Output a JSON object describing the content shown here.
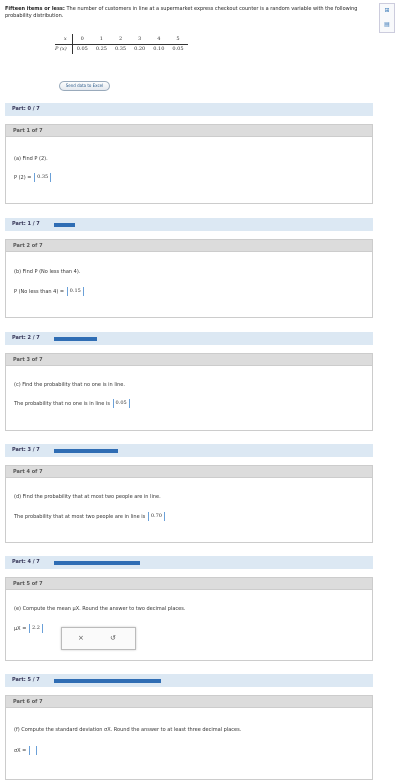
{
  "problem": {
    "title": "Fifteen items or less:",
    "text": "The number of customers in line at a supermarket express checkout counter is a random variable with the following probability distribution."
  },
  "distribution": {
    "x_label": "x",
    "p_label": "P (x)",
    "x_values": [
      "0",
      "1",
      "2",
      "3",
      "4",
      "5"
    ],
    "p_values": [
      "0.05",
      "0.25",
      "0.35",
      "0.20",
      "0.10",
      "0.05"
    ]
  },
  "send_button_label": "Send data to Excel",
  "tools": {
    "calc": "⊞",
    "table": "▤"
  },
  "parts": [
    {
      "bar": "Part: 0 / 7",
      "progress": 0,
      "head": "Part 1 of 7",
      "question": "(a) Find P (2).",
      "answer_label": "P (2) =",
      "answer": "0.35"
    },
    {
      "bar": "Part: 1 / 7",
      "progress": 0.143,
      "head": "Part 2 of 7",
      "question": "(b) Find P (No less than 4).",
      "answer_label": "P (No less than 4) =",
      "answer": "0.15"
    },
    {
      "bar": "Part: 2 / 7",
      "progress": 0.286,
      "head": "Part 3 of 7",
      "question": "(c) Find the probability that no one is in line.",
      "answer_label": "The probability that no one is in line is",
      "answer": "0.05"
    },
    {
      "bar": "Part: 3 / 7",
      "progress": 0.429,
      "head": "Part 4 of 7",
      "question": "(d) Find the probability that at most two people are in line.",
      "answer_label": "The probability that at most two people are in line is",
      "answer": "0.70"
    },
    {
      "bar": "Part: 4 / 7",
      "progress": 0.571,
      "head": "Part 5 of 7",
      "question": "(e) Compute the mean μX. Round the answer to two decimal places.",
      "answer_label": "μX =",
      "answer": "2.2"
    },
    {
      "bar": "Part: 5 / 7",
      "progress": 0.714,
      "head": "Part 6 of 7",
      "question": "(f) Compute the standard deviation σX. Round the answer to at least three decimal places.",
      "answer_label": "σX =",
      "answer": ""
    }
  ],
  "popup": {
    "close": "×",
    "undo": "↺"
  }
}
